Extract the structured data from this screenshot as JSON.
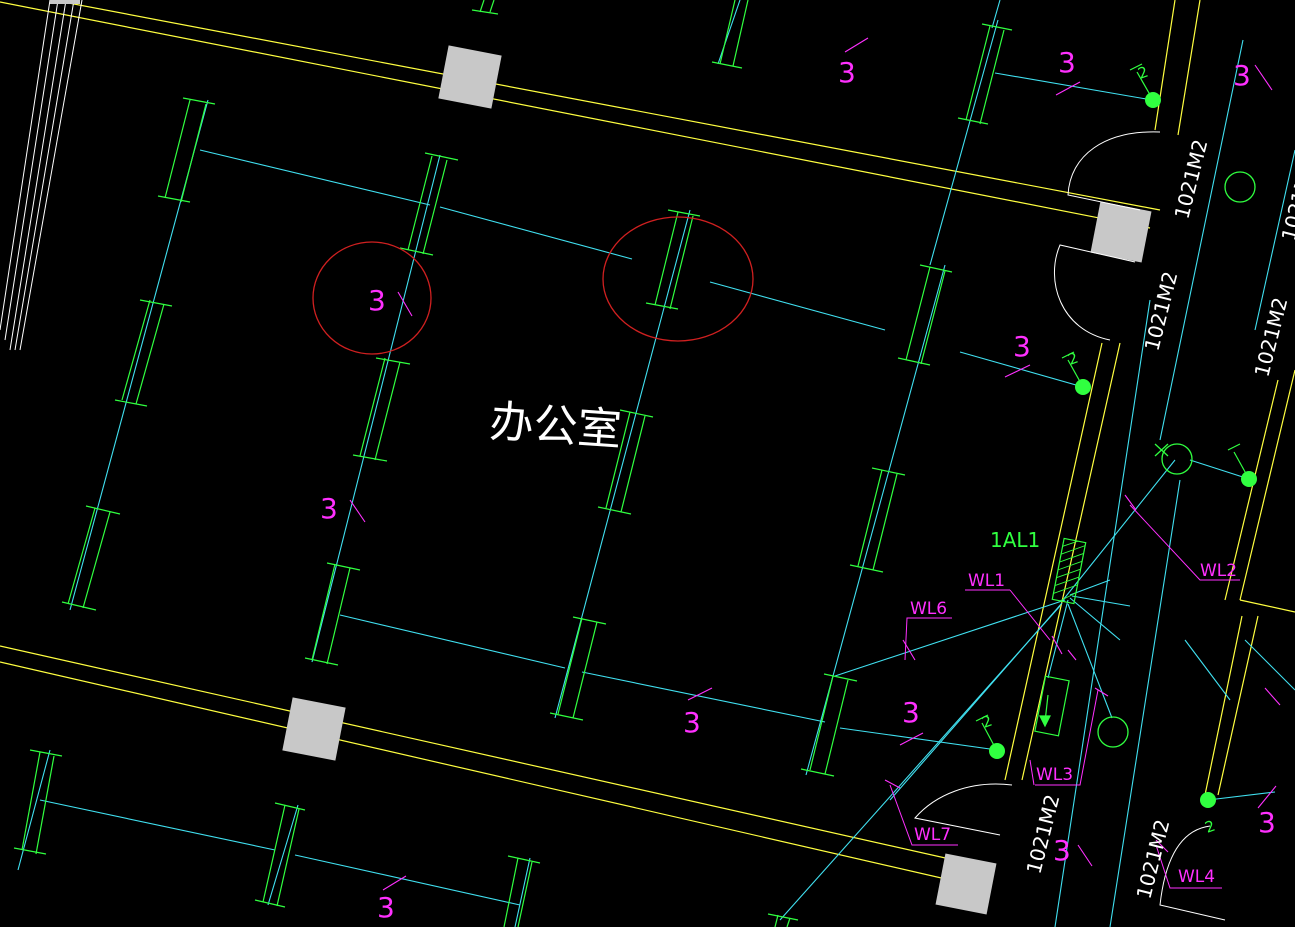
{
  "room_label": "办公室",
  "panel_label": "1AL1",
  "circuits": {
    "wl1": "WL1",
    "wl2": "WL2",
    "wl3": "WL3",
    "wl4": "WL4",
    "wl6": "WL6",
    "wl7": "WL7"
  },
  "door_code": "1021M2",
  "wire_count": "3",
  "switch_mark": "2",
  "colors": {
    "background": "#000000",
    "wall": "#ffff40",
    "wire": "#40e0f0",
    "luminaire": "#30ff40",
    "text_magenta": "#ff30ff",
    "highlight_circle": "#d02020",
    "column": "#c8c8c8",
    "door_arc": "#ffffff"
  }
}
